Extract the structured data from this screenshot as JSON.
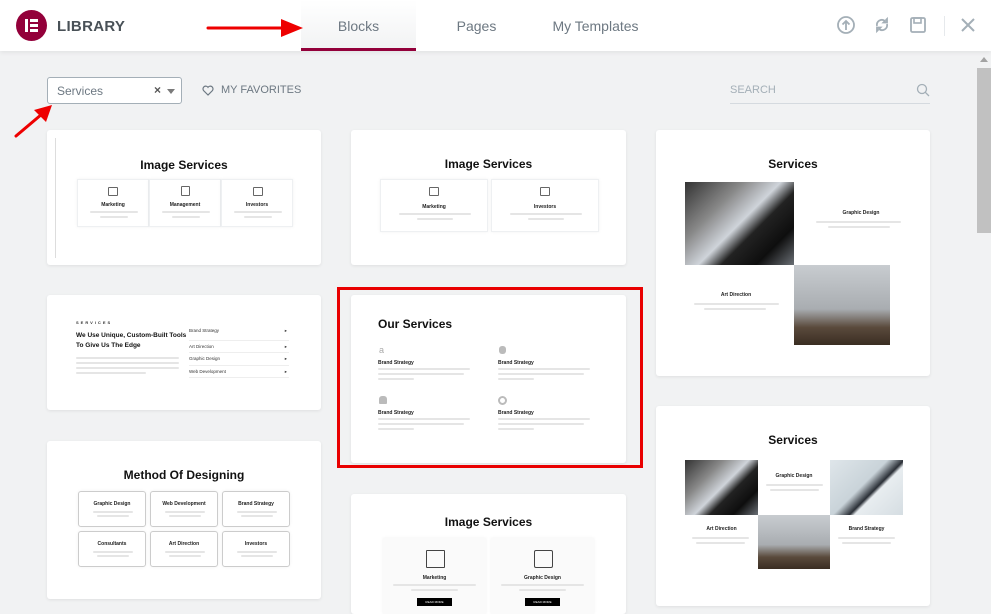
{
  "header": {
    "title": "LIBRARY",
    "tabs": [
      {
        "label": "Blocks",
        "active": true
      },
      {
        "label": "Pages",
        "active": false
      },
      {
        "label": "My Templates",
        "active": false
      }
    ],
    "icons": [
      "upload-icon",
      "sync-icon",
      "save-icon",
      "close-icon"
    ]
  },
  "toolbar": {
    "category_filter": {
      "value": "Services",
      "clear": "×"
    },
    "favorites_label": "MY FAVORITES",
    "search_placeholder": "SEARCH"
  },
  "colors": {
    "accent": "#93003a",
    "highlight": "#e90000"
  },
  "templates": [
    {
      "title": "Image Services",
      "items": [
        "Marketing",
        "Management",
        "Investors"
      ]
    },
    {
      "title": "Image Services",
      "items": [
        "Marketing",
        "Investors"
      ]
    },
    {
      "title": "Services",
      "items": [
        "Graphic Design",
        "Art Direction"
      ]
    },
    {
      "title": "SERVICES",
      "heading": "We Use Unique, Custom-Built Tools To Give Us The Edge",
      "items": [
        "Brand Strategy",
        "Art Direction",
        "Graphic Design",
        "Web Development"
      ]
    },
    {
      "title": "Our Services",
      "items": [
        "Brand Strategy",
        "Brand Strategy",
        "Brand Strategy",
        "Brand Strategy"
      ]
    },
    {
      "title": "Services",
      "items": [
        "Graphic Design",
        "Art Direction",
        "Brand Strategy"
      ]
    },
    {
      "title": "Method Of Designing",
      "items": [
        "Graphic Design",
        "Web Development",
        "Brand Strategy",
        "Consultants",
        "Art Direction",
        "Investors"
      ]
    },
    {
      "title": "Image Services",
      "items": [
        "Marketing",
        "Graphic Design"
      ],
      "button": "READ MORE"
    }
  ]
}
